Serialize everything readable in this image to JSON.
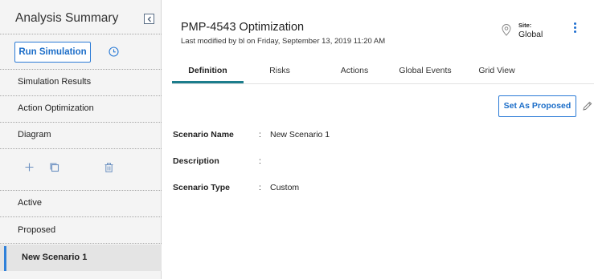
{
  "sidebar": {
    "title": "Analysis Summary",
    "run_simulation_label": "Run Simulation",
    "nav_items": [
      "Simulation Results",
      "Action Optimization",
      "Diagram"
    ],
    "scenarios": [
      "Active",
      "Proposed",
      "New Scenario 1"
    ],
    "selected_scenario": "New Scenario 1"
  },
  "header": {
    "title": "PMP-4543 Optimization",
    "subtitle": "Last modified by bl on Friday, September 13, 2019 11:20 AM",
    "site_label": "Site:",
    "site_value": "Global"
  },
  "tabs": [
    "Definition",
    "Risks",
    "Actions",
    "Global Events",
    "Grid View"
  ],
  "active_tab": "Definition",
  "toolbar": {
    "set_as_proposed_label": "Set As Proposed"
  },
  "fields": [
    {
      "label": "Scenario Name",
      "colon": ":",
      "value": "New Scenario 1"
    },
    {
      "label": "Description",
      "colon": ":",
      "value": ""
    },
    {
      "label": "Scenario Type",
      "colon": ":",
      "value": "Custom"
    }
  ],
  "icons": {
    "collapse": "chevron-left-icon",
    "history": "clock-icon",
    "add": "plus-icon",
    "copy": "copy-icon",
    "delete": "trash-icon",
    "site": "location-pin-icon",
    "more": "kebab-menu-icon",
    "edit": "pencil-icon"
  },
  "colors": {
    "accent_blue": "#2b7bd6",
    "tab_underline": "#1c7d8c",
    "sidebar_bg": "#f4f4f4",
    "selected_bg": "#e4e4e4"
  }
}
